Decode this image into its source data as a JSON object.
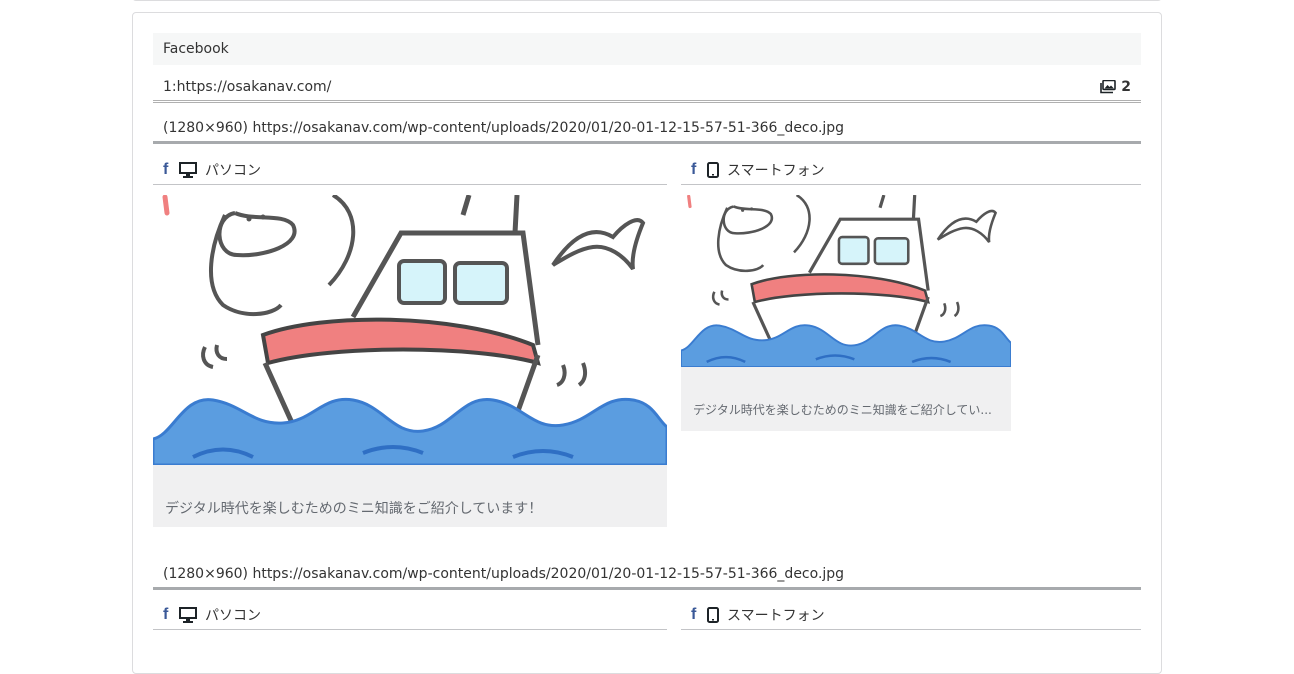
{
  "sns": {
    "name": "Facebook"
  },
  "url": {
    "label": "1:https://osakanav.com/",
    "image_count": "2"
  },
  "images": [
    {
      "label": "(1280×960) https://osakanav.com/wp-content/uploads/2020/01/20-01-12-15-57-51-366_deco.jpg",
      "pc_label": "パソコン",
      "sp_label": "スマートフォン",
      "pc_caption": "デジタル時代を楽しむためのミニ知識をご紹介しています！",
      "sp_caption": "デジタル時代を楽しむためのミニ知識をご紹介してい..."
    },
    {
      "label": "(1280×960) https://osakanav.com/wp-content/uploads/2020/01/20-01-12-15-57-51-366_deco.jpg",
      "pc_label": "パソコン",
      "sp_label": "スマートフォン"
    }
  ],
  "colors": {
    "facebook": "#3b5998",
    "sea": "#5b9de0",
    "boat_band": "#f08080"
  },
  "icons": {
    "facebook": "facebook-icon",
    "desktop": "desktop-icon",
    "smartphone": "smartphone-icon",
    "images": "images-icon"
  }
}
